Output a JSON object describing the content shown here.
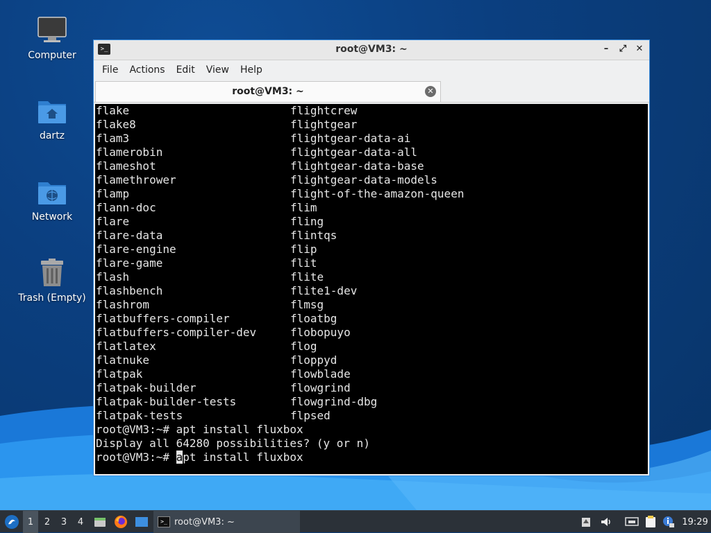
{
  "desktop": {
    "icons": [
      {
        "label": "Computer",
        "icon": "monitor-icon"
      },
      {
        "label": "dartz",
        "icon": "home-folder-icon"
      },
      {
        "label": "Network",
        "icon": "network-folder-icon"
      },
      {
        "label": "Trash (Empty)",
        "icon": "trash-icon"
      }
    ]
  },
  "window": {
    "title": "root@VM3: ~",
    "controls": {
      "minimize": "–",
      "maximize": "⤢",
      "close": "✕"
    },
    "menu": [
      "File",
      "Actions",
      "Edit",
      "View",
      "Help"
    ],
    "tab": {
      "title": "root@VM3: ~",
      "close": "✕"
    }
  },
  "terminal": {
    "columns": [
      [
        "flake",
        "flightcrew"
      ],
      [
        "flake8",
        "flightgear"
      ],
      [
        "flam3",
        "flightgear-data-ai"
      ],
      [
        "flamerobin",
        "flightgear-data-all"
      ],
      [
        "flameshot",
        "flightgear-data-base"
      ],
      [
        "flamethrower",
        "flightgear-data-models"
      ],
      [
        "flamp",
        "flight-of-the-amazon-queen"
      ],
      [
        "flann-doc",
        "flim"
      ],
      [
        "flare",
        "fling"
      ],
      [
        "flare-data",
        "flintqs"
      ],
      [
        "flare-engine",
        "flip"
      ],
      [
        "flare-game",
        "flit"
      ],
      [
        "flash",
        "flite"
      ],
      [
        "flashbench",
        "flite1-dev"
      ],
      [
        "flashrom",
        "flmsg"
      ],
      [
        "flatbuffers-compiler",
        "floatbg"
      ],
      [
        "flatbuffers-compiler-dev",
        "flobopuyo"
      ],
      [
        "flatlatex",
        "flog"
      ],
      [
        "flatnuke",
        "floppyd"
      ],
      [
        "flatpak",
        "flowblade"
      ],
      [
        "flatpak-builder",
        "flowgrind"
      ],
      [
        "flatpak-builder-tests",
        "flowgrind-dbg"
      ],
      [
        "flatpak-tests",
        "flpsed"
      ]
    ],
    "line_cmd1": "root@VM3:~# apt install fluxbox",
    "line_prompt": "Display all 64280 possibilities? (y or n)",
    "line_last_prefix": "root@VM3:~# ",
    "line_last_cursor_char": "a",
    "line_last_rest": "pt install fluxbox"
  },
  "taskbar": {
    "workspaces": [
      "1",
      "2",
      "3",
      "4"
    ],
    "task_label": "root@VM3: ~",
    "clock": "19:29"
  }
}
